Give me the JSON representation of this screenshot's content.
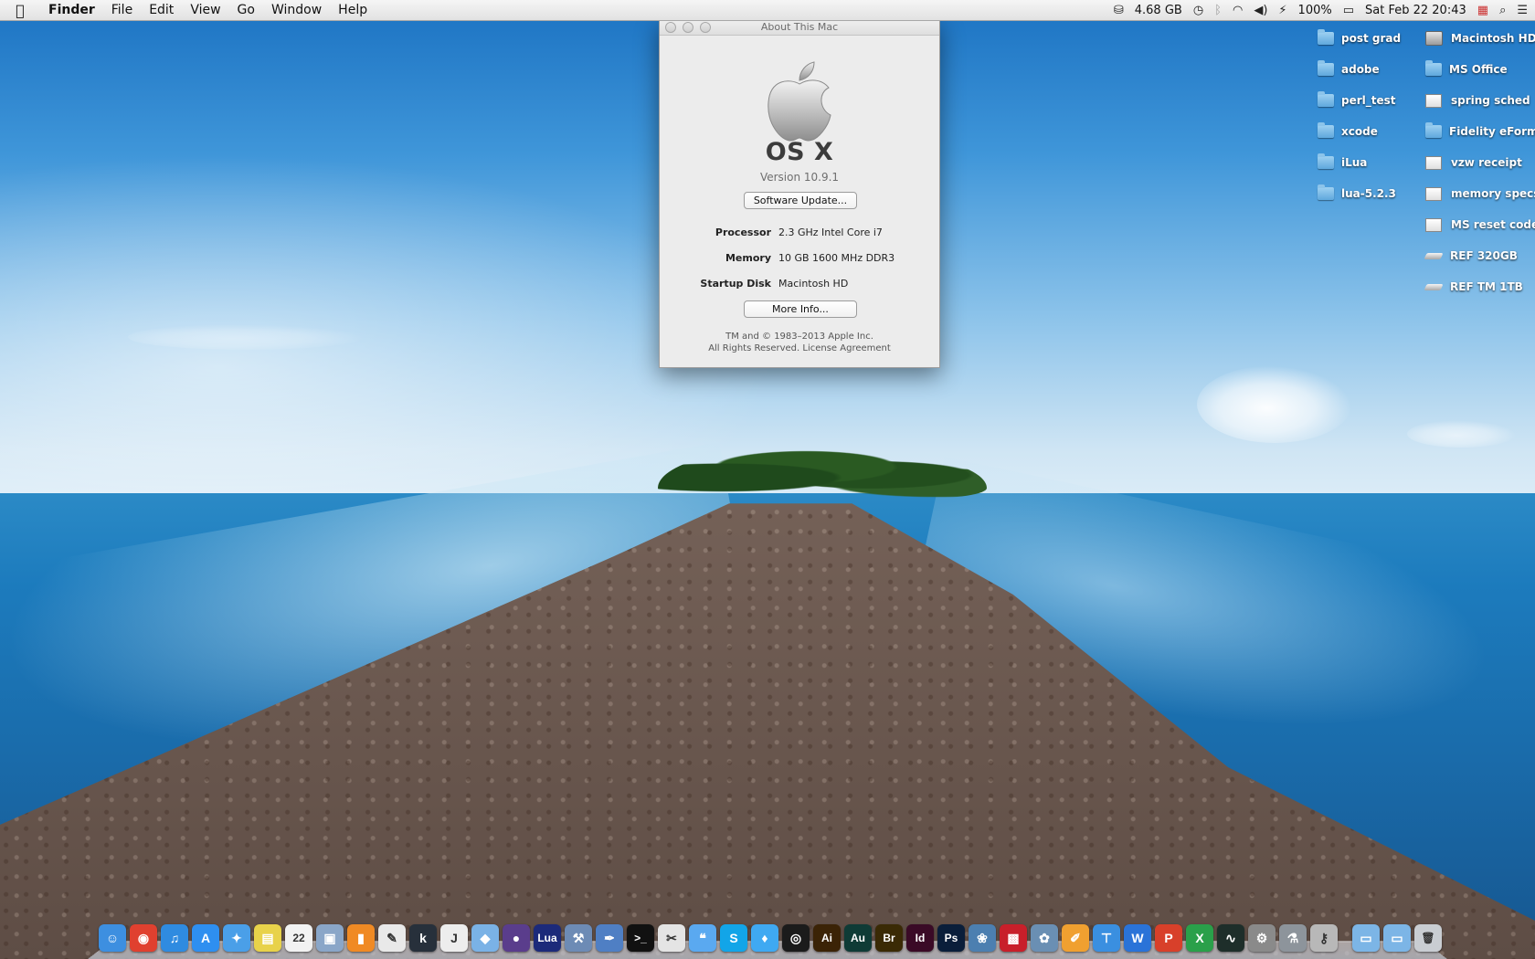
{
  "menubar": {
    "app_name": "Finder",
    "menus": [
      "File",
      "Edit",
      "View",
      "Go",
      "Window",
      "Help"
    ],
    "status": {
      "memory": "4.68 GB",
      "battery": "100%",
      "datetime": "Sat Feb 22  20:43"
    }
  },
  "about_window": {
    "title": "About This Mac",
    "os_name": "OS X",
    "version": "Version 10.9.1",
    "software_update_label": "Software Update...",
    "specs": [
      {
        "label": "Processor",
        "value": "2.3 GHz Intel Core i7"
      },
      {
        "label": "Memory",
        "value": "10 GB 1600 MHz DDR3"
      },
      {
        "label": "Startup Disk",
        "value": "Macintosh HD"
      }
    ],
    "more_info_label": "More Info...",
    "copyright_line1": "TM and © 1983–2013 Apple Inc.",
    "copyright_line2": "All Rights Reserved.  License Agreement"
  },
  "desktop": {
    "column1": [
      {
        "label": "post grad",
        "icon": "folder-icon"
      },
      {
        "label": "adobe",
        "icon": "folder-icon"
      },
      {
        "label": "perl_test",
        "icon": "folder-icon"
      },
      {
        "label": "xcode",
        "icon": "folder-icon"
      },
      {
        "label": "iLua",
        "icon": "folder-icon"
      },
      {
        "label": "lua-5.2.3",
        "icon": "folder-icon"
      }
    ],
    "column2": [
      {
        "label": "Macintosh HD",
        "icon": "drive-icon"
      },
      {
        "label": "MS Office",
        "icon": "folder-icon"
      },
      {
        "label": "spring sched",
        "icon": "doc-icon"
      },
      {
        "label": "Fidelity eForm",
        "icon": "folder-icon"
      },
      {
        "label": "vzw receipt",
        "icon": "doc-icon"
      },
      {
        "label": "memory specs",
        "icon": "doc-icon"
      },
      {
        "label": "MS reset code",
        "icon": "doc-icon"
      },
      {
        "label": "REF 320GB",
        "icon": "ext-drive-icon"
      },
      {
        "label": "REF TM 1TB",
        "icon": "ext-drive-icon"
      }
    ]
  },
  "dock": {
    "apps": [
      {
        "name": "finder-icon",
        "glyph": "☺",
        "color": "#3d8fe0"
      },
      {
        "name": "chrome-icon",
        "glyph": "◉",
        "color": "#e0402f"
      },
      {
        "name": "itunes-icon",
        "glyph": "♫",
        "color": "#2f8be0"
      },
      {
        "name": "app-store-icon",
        "glyph": "A",
        "color": "#2e8ff0"
      },
      {
        "name": "safari-icon",
        "glyph": "✦",
        "color": "#4a9fe8"
      },
      {
        "name": "stickies-icon",
        "glyph": "▤",
        "color": "#e8d24a"
      },
      {
        "name": "calendar-icon",
        "glyph": "22",
        "color": "#f2f2f2"
      },
      {
        "name": "preview-icon",
        "glyph": "▣",
        "color": "#8aa6c8"
      },
      {
        "name": "ibooks-icon",
        "glyph": "▮",
        "color": "#f08a24"
      },
      {
        "name": "textedit-icon",
        "glyph": "✎",
        "color": "#e9e9e9"
      },
      {
        "name": "kindle-icon",
        "glyph": "k",
        "color": "#27303b"
      },
      {
        "name": "java-icon",
        "glyph": "J",
        "color": "#ededed"
      },
      {
        "name": "virtualbox-icon",
        "glyph": "◆",
        "color": "#7ab2e6"
      },
      {
        "name": "eclipse-icon",
        "glyph": "●",
        "color": "#5a3d8c"
      },
      {
        "name": "lua-icon",
        "glyph": "Lua",
        "color": "#1c2a7a"
      },
      {
        "name": "xcode-icon",
        "glyph": "⚒",
        "color": "#6d8bb5"
      },
      {
        "name": "text-editor-icon",
        "glyph": "✒",
        "color": "#4f7fc4"
      },
      {
        "name": "terminal-icon",
        "glyph": ">_",
        "color": "#111111"
      },
      {
        "name": "script-editor-icon",
        "glyph": "✂",
        "color": "#e4e4e4"
      },
      {
        "name": "messages-icon",
        "glyph": "❝",
        "color": "#5aa9f0"
      },
      {
        "name": "skype-icon",
        "glyph": "S",
        "color": "#12a5e8"
      },
      {
        "name": "twitter-icon",
        "glyph": "♦",
        "color": "#3fa9f2"
      },
      {
        "name": "dvd-player-icon",
        "glyph": "◎",
        "color": "#1b1b1b"
      },
      {
        "name": "illustrator-icon",
        "glyph": "Ai",
        "color": "#3b2306"
      },
      {
        "name": "audition-icon",
        "glyph": "Au",
        "color": "#0f3b36"
      },
      {
        "name": "bridge-icon",
        "glyph": "Br",
        "color": "#3a2a05"
      },
      {
        "name": "indesign-icon",
        "glyph": "Id",
        "color": "#3a0a26"
      },
      {
        "name": "photoshop-icon",
        "glyph": "Ps",
        "color": "#0a1e3a"
      },
      {
        "name": "iphoto-icon",
        "glyph": "❀",
        "color": "#4c7fb0"
      },
      {
        "name": "photo-booth-icon",
        "glyph": "▩",
        "color": "#c81f2a"
      },
      {
        "name": "image-capture-icon",
        "glyph": "✿",
        "color": "#6a8fb3"
      },
      {
        "name": "pages-icon",
        "glyph": "✐",
        "color": "#f0a030"
      },
      {
        "name": "keynote-icon",
        "glyph": "⊤",
        "color": "#3a8fe0"
      },
      {
        "name": "word-icon",
        "glyph": "W",
        "color": "#2a73d8"
      },
      {
        "name": "powerpoint-icon",
        "glyph": "P",
        "color": "#d8402a"
      },
      {
        "name": "excel-icon",
        "glyph": "X",
        "color": "#2aa04a"
      },
      {
        "name": "activity-monitor-icon",
        "glyph": "∿",
        "color": "#1e2e2a"
      },
      {
        "name": "system-preferences-icon",
        "glyph": "⚙",
        "color": "#8a8a8a"
      },
      {
        "name": "utilities-icon",
        "glyph": "⚗",
        "color": "#8d949b"
      },
      {
        "name": "keychain-icon",
        "glyph": "⚷",
        "color": "#b8b8b8"
      },
      {
        "name": "applications-folder-icon",
        "glyph": "▭",
        "color": "#7cb5e6"
      },
      {
        "name": "downloads-folder-icon",
        "glyph": "▭",
        "color": "#7cb5e6"
      },
      {
        "name": "trash-icon",
        "glyph": "🗑",
        "color": "#c9cdd2"
      }
    ]
  }
}
